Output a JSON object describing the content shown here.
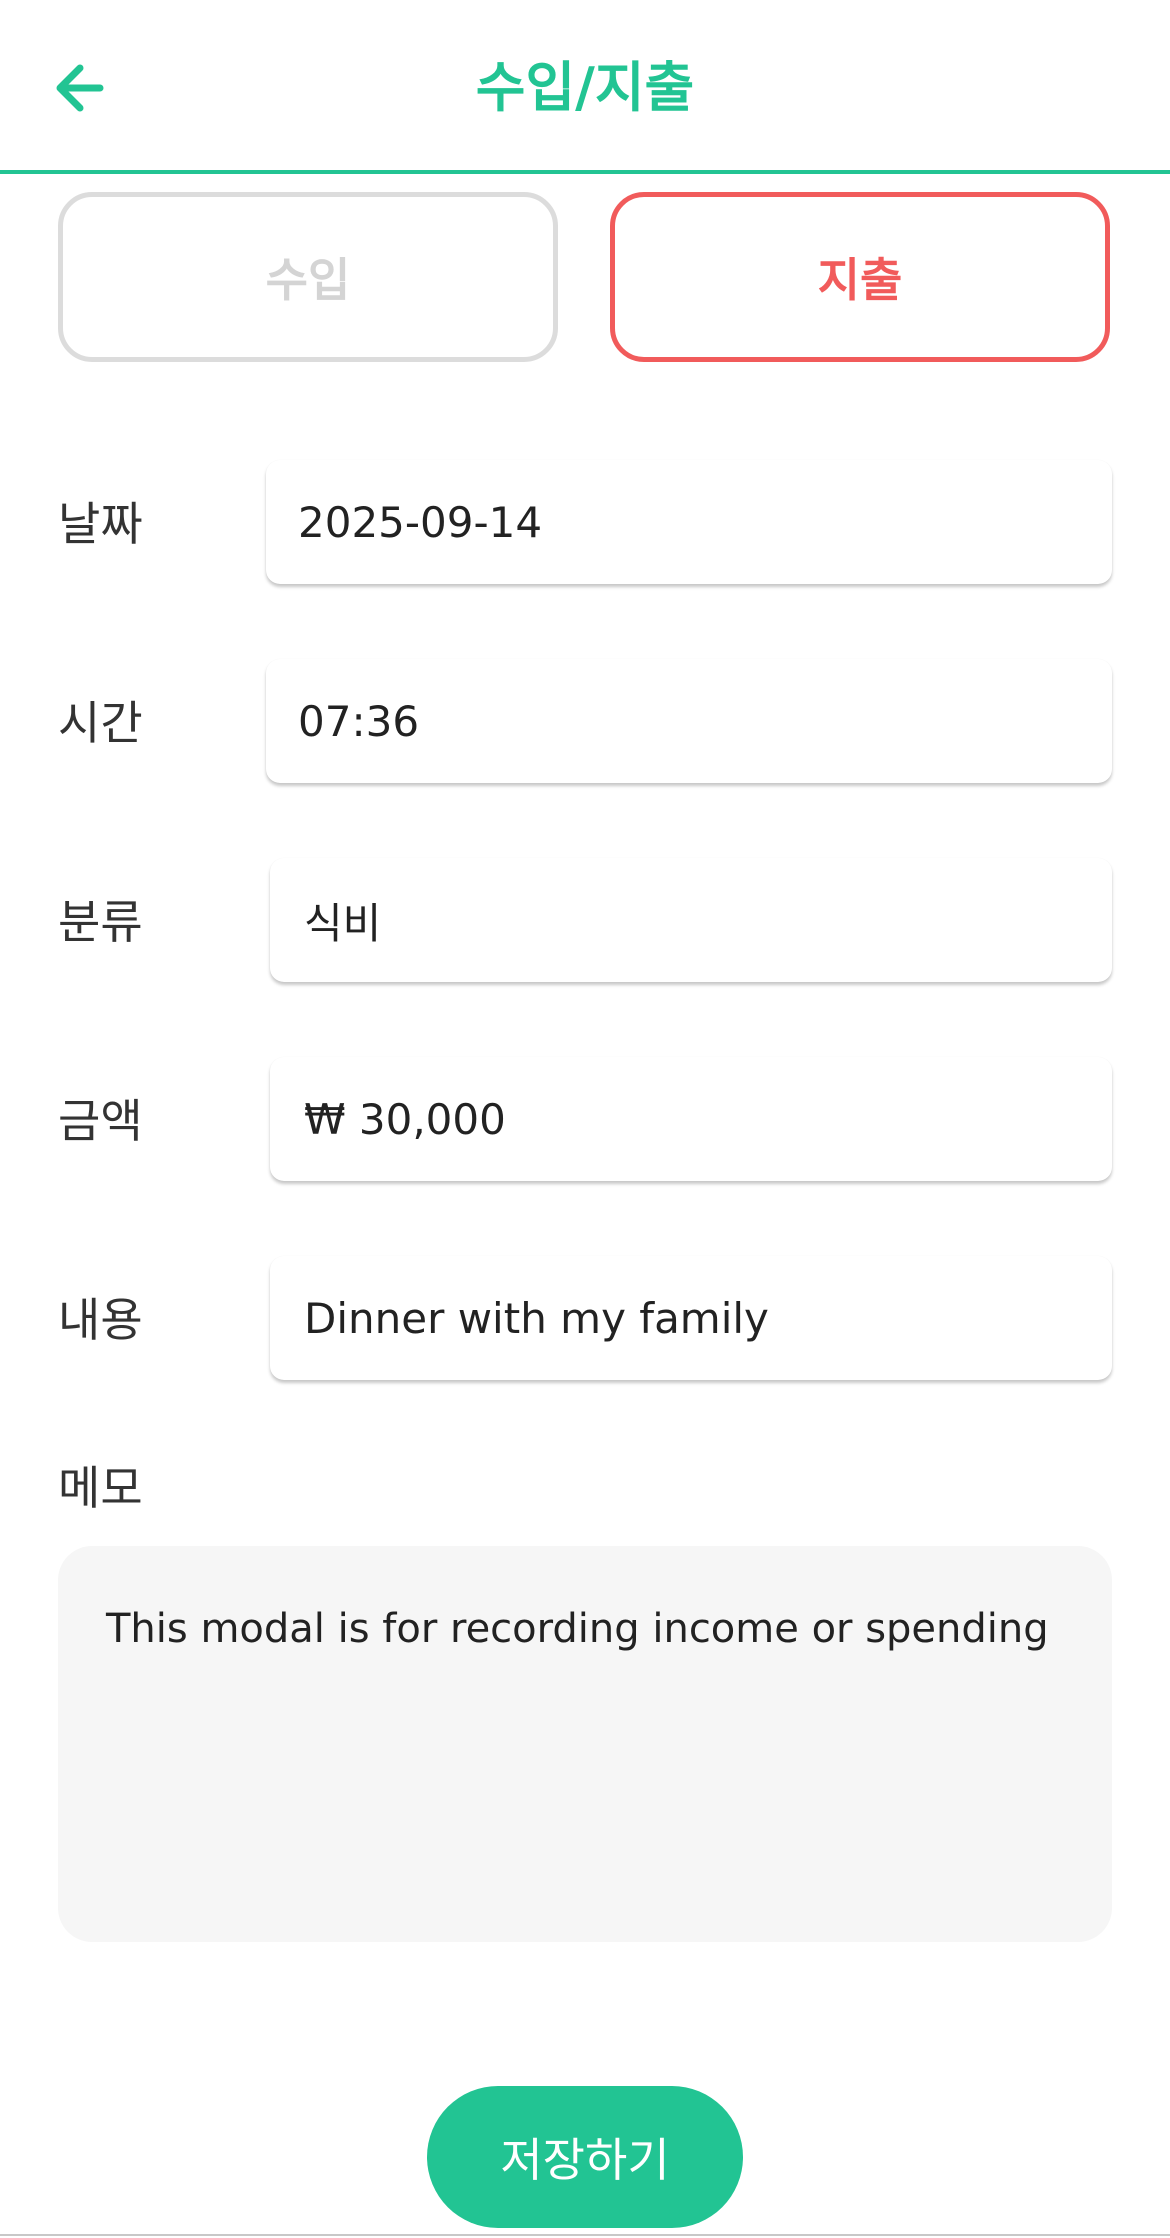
{
  "header": {
    "title": "수입/지출",
    "back_icon": "arrow-left-icon"
  },
  "type_toggle": {
    "income_label": "수입",
    "expense_label": "지출",
    "selected": "지출"
  },
  "form": {
    "date_label": "날짜",
    "date_value": "2025-09-14",
    "time_label": "시간",
    "time_value": "07:36",
    "category_label": "분류",
    "category_value": "식비",
    "amount_label": "금액",
    "amount_value": "₩ 30,000",
    "description_label": "내용",
    "description_value": "Dinner with my family",
    "memo_label": "메모",
    "memo_value": "This modal is for recording income or spending"
  },
  "save_label": "저장하기",
  "colors": {
    "accent": "#22c493",
    "expense": "#f15b5b",
    "inactive": "#d4d4d4",
    "memo_background": "#f6f6f6"
  }
}
